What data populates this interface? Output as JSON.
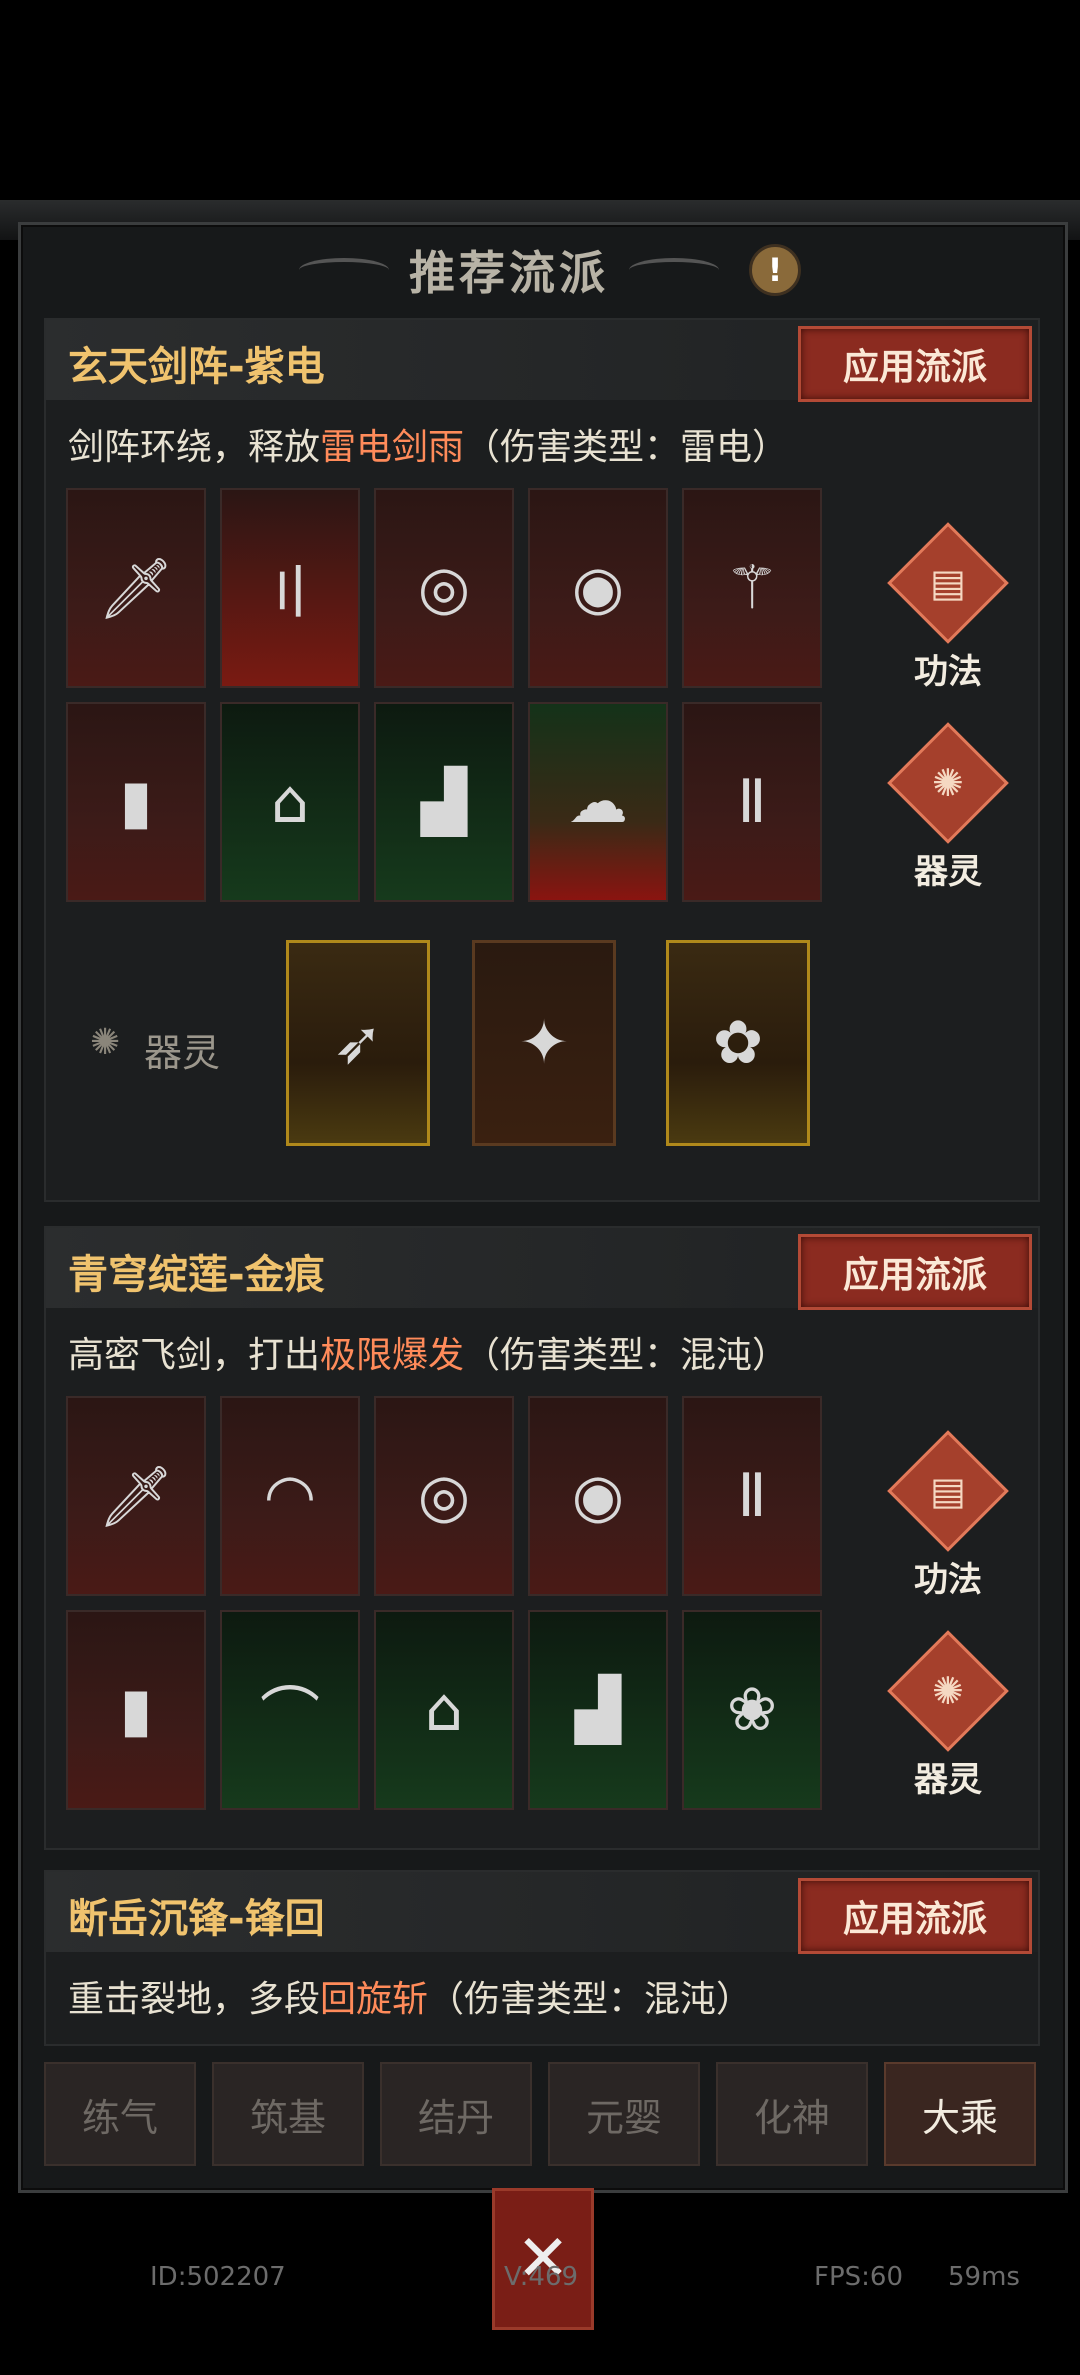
{
  "header": {
    "title": "推荐流派",
    "info_icon": "exclamation-icon"
  },
  "builds": [
    {
      "name": "玄天剑阵-紫电",
      "apply_label": "应用流派",
      "desc_prefix": "剑阵环绕，释放",
      "desc_highlight": "雷电剑雨",
      "desc_suffix": "（伤害类型：雷电）",
      "side_buttons": [
        {
          "label": "功法",
          "icon": "book-icon"
        },
        {
          "label": "器灵",
          "icon": "beast-icon"
        }
      ],
      "spirit_label": "器灵"
    },
    {
      "name": "青穹绽莲-金痕",
      "apply_label": "应用流派",
      "desc_prefix": "高密飞剑，打出",
      "desc_highlight": "极限爆发",
      "desc_suffix": "（伤害类型：混沌）",
      "side_buttons": [
        {
          "label": "功法",
          "icon": "book-icon"
        },
        {
          "label": "器灵",
          "icon": "beast-icon"
        }
      ]
    },
    {
      "name": "断岳沉锋-锋回",
      "apply_label": "应用流派",
      "desc_prefix": "重击裂地，多段",
      "desc_highlight": "回旋斩",
      "desc_suffix": "（伤害类型：混沌）"
    }
  ],
  "tabs": [
    "练气",
    "筑基",
    "结丹",
    "元婴",
    "化神",
    "大乘"
  ],
  "active_tab": "大乘",
  "status": {
    "id": "ID:502207",
    "version": "V:469",
    "fps": "FPS:60",
    "latency": "59ms"
  },
  "colors": {
    "accent": "#f0c36e",
    "highlight": "#ff8b5a",
    "button": "#8b2b20"
  }
}
